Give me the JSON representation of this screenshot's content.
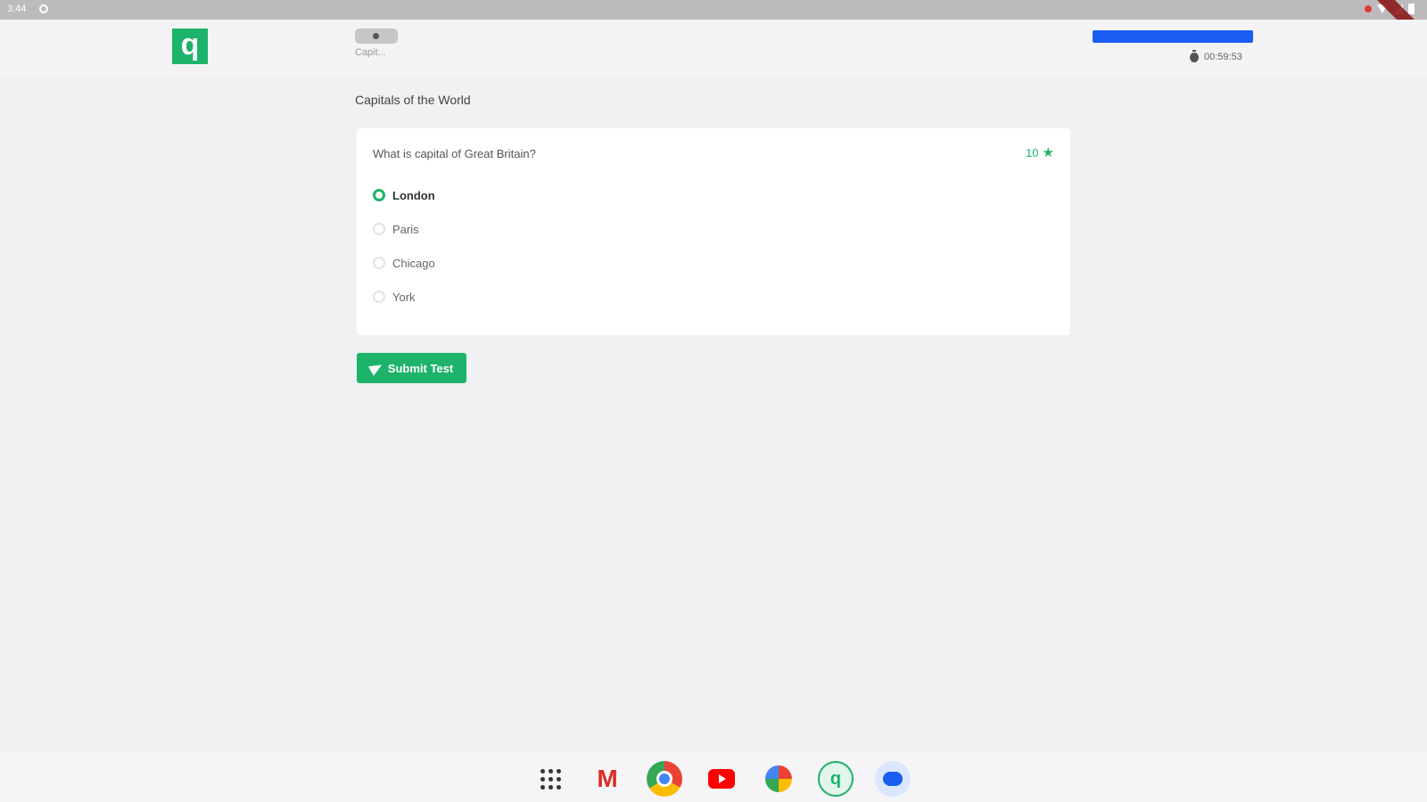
{
  "status_bar": {
    "time": "3:44"
  },
  "header": {
    "logo_letter": "q",
    "question_nav_label": "Capit...",
    "progress_pct": 100,
    "timer": "00:59:53"
  },
  "quiz": {
    "title": "Capitals of the World",
    "question": "What is capital of Great Britain?",
    "points": "10",
    "options": [
      {
        "label": "London",
        "selected": true
      },
      {
        "label": "Paris",
        "selected": false
      },
      {
        "label": "Chicago",
        "selected": false
      },
      {
        "label": "York",
        "selected": false
      }
    ],
    "submit_label": "Submit Test"
  },
  "taskbar": {
    "apps": [
      "app-launcher-icon",
      "gmail-icon",
      "chrome-icon",
      "youtube-icon",
      "photos-icon",
      "quiz-app-icon",
      "messages-icon"
    ],
    "quiz_app_letter": "q",
    "gmail_letter": "M"
  },
  "colors": {
    "accent": "#1db36a",
    "progress": "#1a5cf0"
  }
}
